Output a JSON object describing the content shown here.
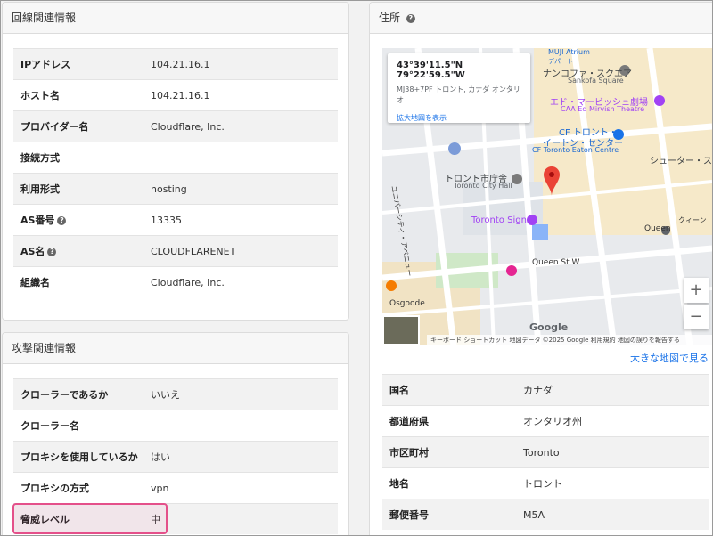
{
  "line_info": {
    "header": "回線関連情報",
    "rows": [
      {
        "key": "IPアドレス",
        "value": "104.21.16.1",
        "help": false
      },
      {
        "key": "ホスト名",
        "value": "104.21.16.1",
        "help": false
      },
      {
        "key": "プロバイダー名",
        "value": "Cloudflare, Inc.",
        "help": false
      },
      {
        "key": "接続方式",
        "value": "",
        "help": false
      },
      {
        "key": "利用形式",
        "value": "hosting",
        "help": false
      },
      {
        "key": "AS番号",
        "value": "13335",
        "help": true
      },
      {
        "key": "AS名",
        "value": "CLOUDFLARENET",
        "help": true
      },
      {
        "key": "組織名",
        "value": "Cloudflare, Inc.",
        "help": false
      }
    ]
  },
  "attack_info": {
    "header": "攻撃関連情報",
    "rows": [
      {
        "key": "クローラーであるか",
        "value": "いいえ"
      },
      {
        "key": "クローラー名",
        "value": ""
      },
      {
        "key": "プロキシを使用しているか",
        "value": "はい"
      },
      {
        "key": "プロキシの方式",
        "value": "vpn"
      },
      {
        "key": "脅威レベル",
        "value": "中"
      }
    ]
  },
  "address": {
    "header": "住所",
    "map": {
      "coord": "43°39'11.5\"N 79°22'59.5\"W",
      "plus_code": "MJ38+7PF トロント, カナダ オンタリオ",
      "enlarge_link": "拡大地図を表示",
      "labels": {
        "muji": "MUJI Atrium",
        "muji_sub": "デパート",
        "sankofa": "ナンコファ・スクエア",
        "sankofa_en": "Sankofa Square",
        "ed": "エド・マービッシュ劇場",
        "ed_en": "CAA Ed Mirvish Theatre",
        "cf": "CF トロント・",
        "cf2": "イートン・センター",
        "cf_en": "CF Toronto Eaton Centre",
        "shuter": "シューター・ス",
        "cityhall": "トロント市庁舎",
        "cityhall_en": "Toronto City Hall",
        "sign": "Toronto Sign",
        "queen": "Queen",
        "queen_w": "Queen St W",
        "osgoode": "Osgoode",
        "univ": "ユニバーシティ・アベニュー",
        "queen_r": "クィーン"
      },
      "zoom_in": "+",
      "zoom_out": "−",
      "google": "Google",
      "attribution": "キーボード ショートカット   地図データ ©2025 Google   利用規約   地図の誤りを報告する"
    },
    "big_map_link": "大きな地図で見る",
    "rows": [
      {
        "key": "国名",
        "value": "カナダ"
      },
      {
        "key": "都道府県",
        "value": "オンタリオ州"
      },
      {
        "key": "市区町村",
        "value": "Toronto"
      },
      {
        "key": "地名",
        "value": "トロント"
      },
      {
        "key": "郵便番号",
        "value": "M5A"
      }
    ]
  },
  "help_icon": "?"
}
